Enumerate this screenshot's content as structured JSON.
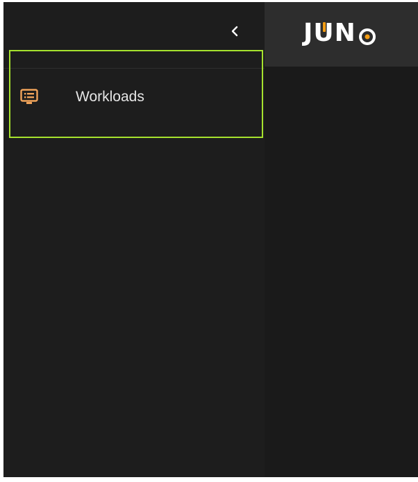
{
  "brand": {
    "logo_text_prefix": "J",
    "logo_text_u": "U",
    "logo_text_n": "N",
    "logo_text_o": "O",
    "accent_color": "#f39c12"
  },
  "sidebar": {
    "collapse_icon": "chevron-left-icon",
    "items": [
      {
        "label": "Workloads",
        "icon": "monitor-list-icon",
        "icon_color": "#f0a35a",
        "selected": true,
        "highlight_color": "#a6e22e"
      }
    ]
  }
}
